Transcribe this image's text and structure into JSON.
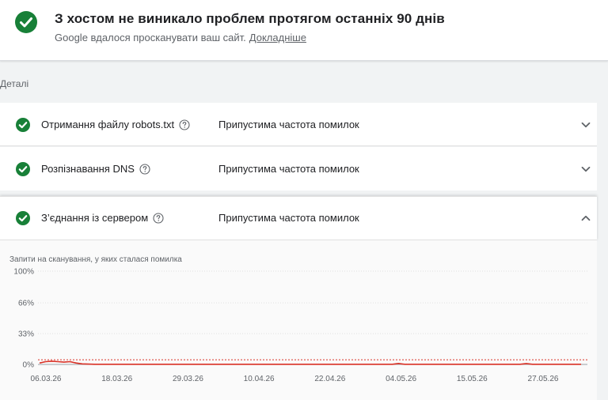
{
  "header": {
    "title": "З хостом не виникало проблем протягом останніх 90 днів",
    "subtitle": "Google вдалося просканувати ваш сайт.",
    "link": "Докладніше",
    "status_color": "#188038"
  },
  "details": {
    "label": "Деталі",
    "rows": [
      {
        "name": "Отримання файлу robots.txt",
        "status": "Припустима частота помилок",
        "expanded": false
      },
      {
        "name": "Розпізнавання DNS",
        "status": "Припустима частота помилок",
        "expanded": false
      },
      {
        "name": "З’єднання із сервером",
        "status": "Припустима частота помилок",
        "expanded": true
      }
    ]
  },
  "chart_data": {
    "type": "line",
    "title": "Запити на сканування, у яких сталася помилка",
    "y_ticks": [
      "100%",
      "66%",
      "33%",
      "0%"
    ],
    "x_ticks": [
      "06.03.26",
      "18.03.26",
      "29.03.26",
      "10.04.26",
      "22.04.26",
      "04.05.26",
      "15.05.26",
      "27.05.26"
    ],
    "ylim": [
      0,
      100
    ],
    "threshold_percent": 5,
    "series": [
      {
        "color": "#d93025",
        "values": [
          1.5,
          3,
          3.5,
          3,
          2.5,
          3,
          1.5,
          0.6,
          0.3,
          0.2,
          0.2,
          0.2,
          0.2,
          0.2,
          0.2,
          0.2,
          0.2,
          0.2,
          0.2,
          0.2,
          0.2,
          0.2,
          0.2,
          0.2,
          0.2,
          0.2,
          0.2,
          0.2,
          0.2,
          0.2,
          0.2,
          0.2,
          0.2,
          0.2,
          0.2,
          0.2,
          0.2,
          0.2,
          0.2,
          0.2,
          0.2,
          0.2,
          0.2,
          0.2,
          0.2,
          0.2,
          0.2,
          0.2,
          0.2,
          0.2,
          0.2,
          0.2,
          0.2,
          0.2,
          0.2,
          0.2,
          0.2,
          0.2,
          0.2,
          1,
          0.2,
          0.2,
          0.2,
          0.2,
          0.2,
          0.2,
          0.2,
          0.2,
          0.2,
          0.2,
          0.2,
          0.2,
          0.2,
          0.2,
          0.2,
          0.2,
          0.2,
          0.2,
          0.2,
          0.2,
          0.9,
          0.2,
          0.2,
          0.2,
          0.2,
          0.2,
          0.2,
          0.2,
          0.2,
          0.2
        ]
      }
    ],
    "grid": true
  }
}
